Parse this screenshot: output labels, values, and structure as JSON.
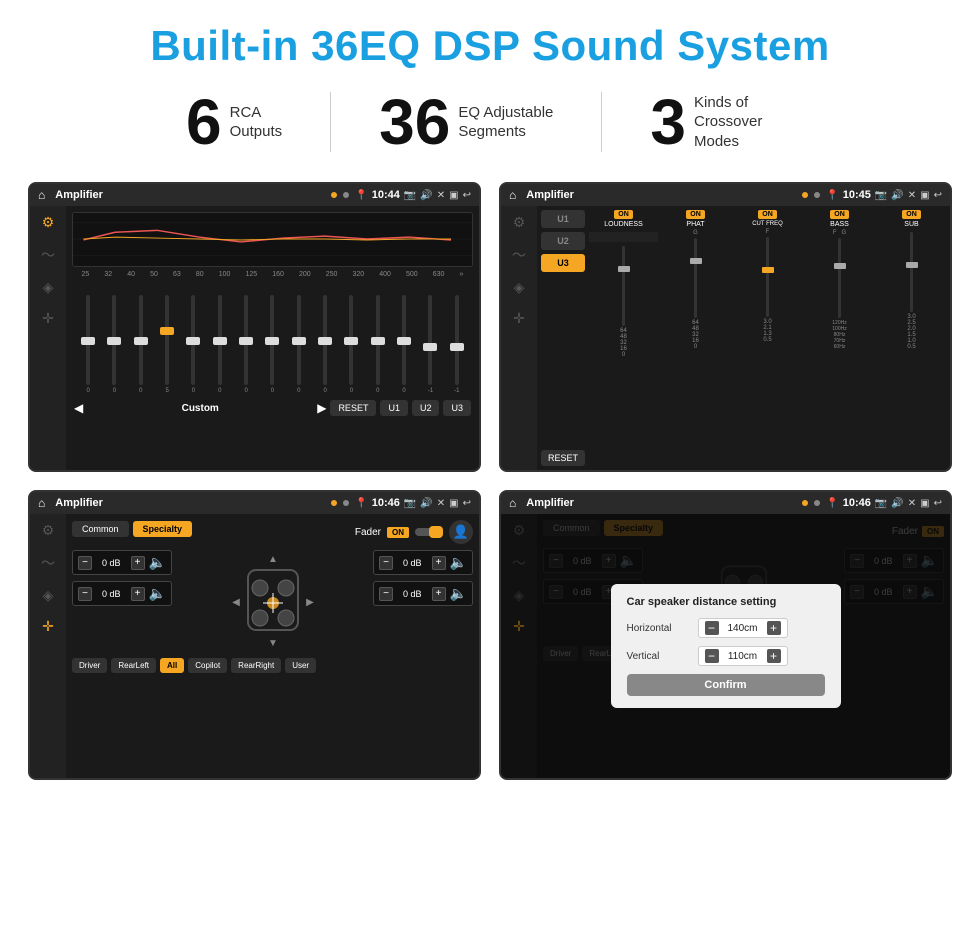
{
  "header": {
    "title": "Built-in 36EQ DSP Sound System"
  },
  "stats": [
    {
      "number": "6",
      "label_line1": "RCA",
      "label_line2": "Outputs"
    },
    {
      "number": "36",
      "label_line1": "EQ Adjustable",
      "label_line2": "Segments"
    },
    {
      "number": "3",
      "label_line1": "Kinds of",
      "label_line2": "Crossover Modes"
    }
  ],
  "screens": [
    {
      "id": "screen1",
      "app_name": "Amplifier",
      "time": "10:44",
      "type": "eq_graphic"
    },
    {
      "id": "screen2",
      "app_name": "Amplifier",
      "time": "10:45",
      "type": "crossover"
    },
    {
      "id": "screen3",
      "app_name": "Amplifier",
      "time": "10:46",
      "type": "fader"
    },
    {
      "id": "screen4",
      "app_name": "Amplifier",
      "time": "10:46",
      "type": "fader_dialog"
    }
  ],
  "eq": {
    "freq_labels": [
      "25",
      "32",
      "40",
      "50",
      "63",
      "80",
      "100",
      "125",
      "160",
      "200",
      "250",
      "320",
      "400",
      "500",
      "630"
    ],
    "values": [
      "0",
      "0",
      "0",
      "5",
      "0",
      "0",
      "0",
      "0",
      "0",
      "0",
      "0",
      "0",
      "0",
      "-1",
      "-1"
    ],
    "preset_name": "Custom",
    "buttons": [
      "RESET",
      "U1",
      "U2",
      "U3"
    ]
  },
  "crossover": {
    "presets": [
      "U1",
      "U2",
      "U3"
    ],
    "active_preset": "U3",
    "channels": [
      "LOUDNESS",
      "PHAT",
      "CUT FREQ",
      "BASS",
      "SUB"
    ],
    "reset_label": "RESET"
  },
  "fader": {
    "tabs": [
      "Common",
      "Specialty"
    ],
    "active_tab": "Specialty",
    "fader_label": "Fader",
    "on_label": "ON",
    "volumes": [
      "0 dB",
      "0 dB",
      "0 dB",
      "0 dB"
    ],
    "bottom_btns": [
      "Driver",
      "RearLeft",
      "All",
      "Copilot",
      "RearRight",
      "User"
    ],
    "active_bottom": "All"
  },
  "dialog": {
    "title": "Car speaker distance setting",
    "horizontal_label": "Horizontal",
    "horizontal_value": "140cm",
    "vertical_label": "Vertical",
    "vertical_value": "110cm",
    "confirm_label": "Confirm"
  }
}
